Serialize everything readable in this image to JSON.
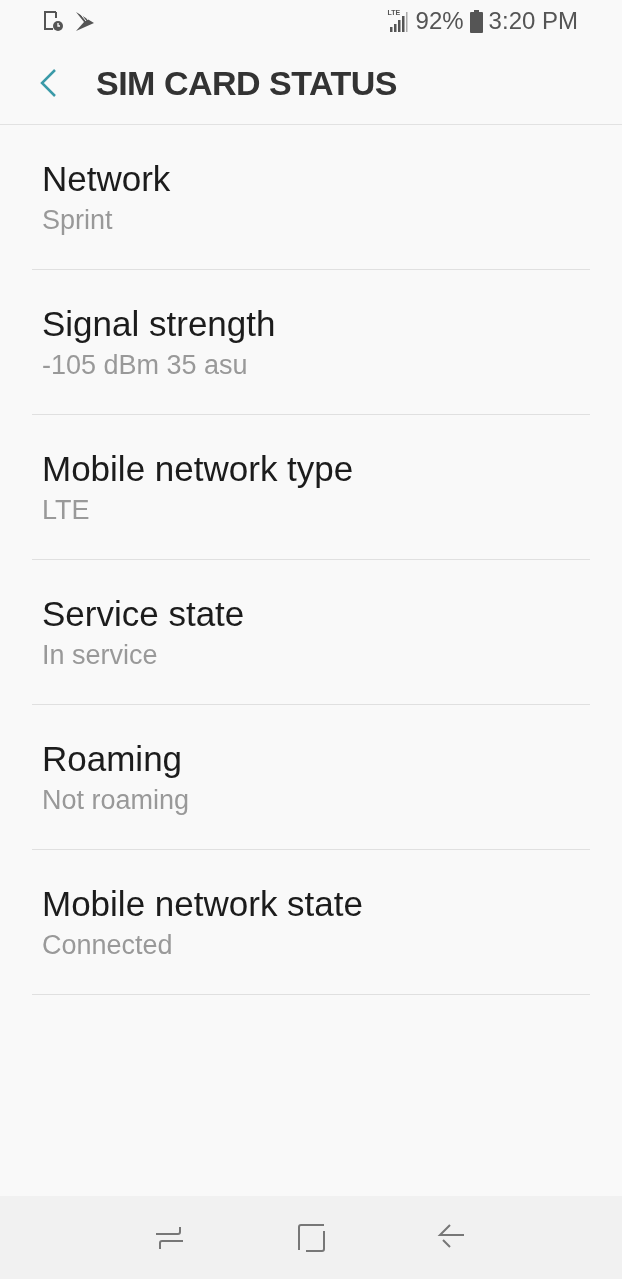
{
  "status_bar": {
    "network_type": "LTE",
    "battery": "92%",
    "time": "3:20 PM"
  },
  "header": {
    "title": "SIM CARD STATUS"
  },
  "items": [
    {
      "title": "Network",
      "value": "Sprint"
    },
    {
      "title": "Signal strength",
      "value": "-105 dBm 35 asu"
    },
    {
      "title": "Mobile network type",
      "value": "LTE"
    },
    {
      "title": "Service state",
      "value": "In service"
    },
    {
      "title": "Roaming",
      "value": "Not roaming"
    },
    {
      "title": "Mobile network state",
      "value": "Connected"
    }
  ]
}
